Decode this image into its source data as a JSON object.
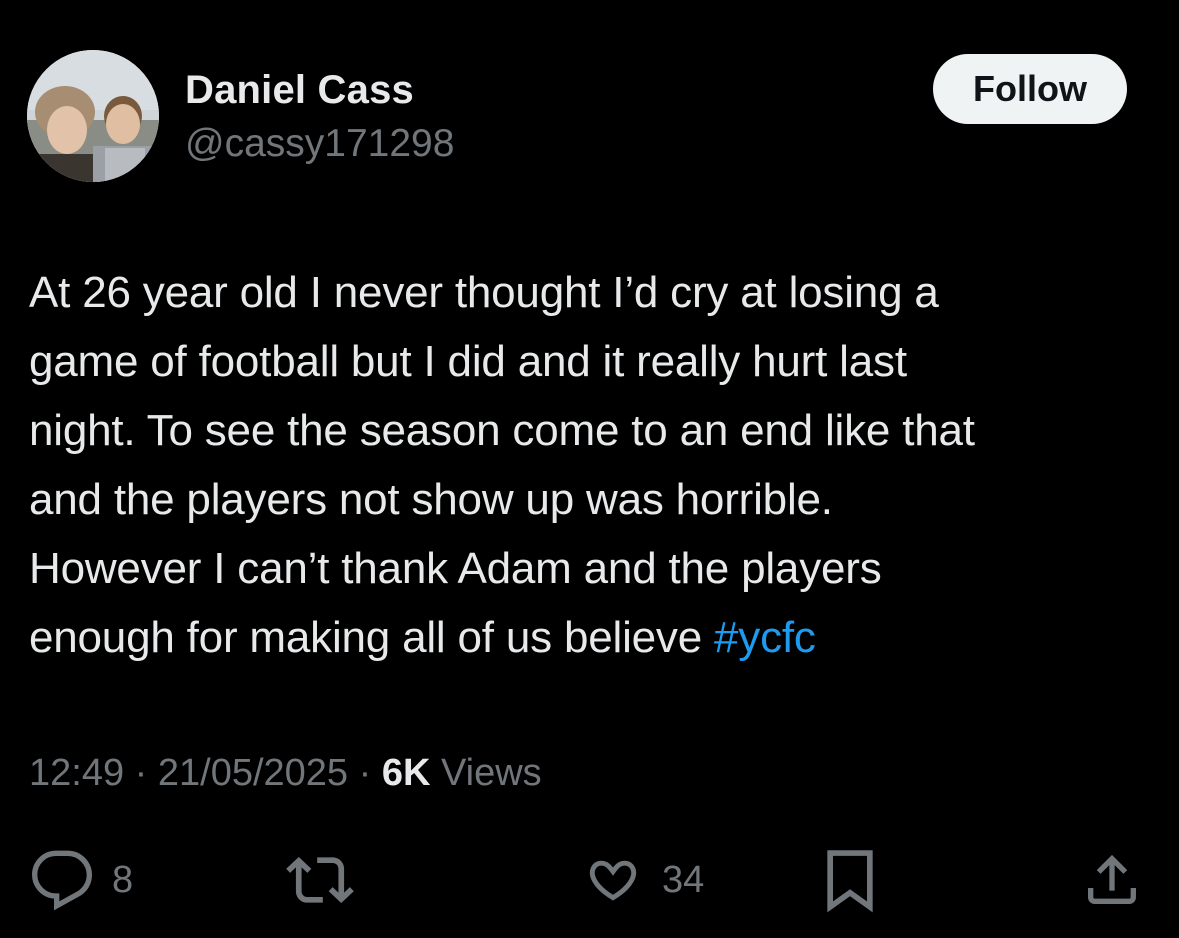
{
  "author": {
    "name": "Daniel Cass",
    "handle": "@cassy171298",
    "follow_label": "Follow"
  },
  "tweet": {
    "lines": [
      "At 26 year old I never thought I’d cry at losing a",
      "game of football but I did and it really hurt last",
      "night. To see the season come to an end like that",
      "and the players not show up was horrible.",
      "However I can’t thank Adam and the players"
    ],
    "last_line_text": "enough for making all of us believe ",
    "hashtag": "#ycfc"
  },
  "meta": {
    "time": "12:49",
    "separator": "·",
    "date": "21/05/2025",
    "views_count": "6K",
    "views_label": "Views"
  },
  "actions": {
    "replies": "8",
    "retweets": "",
    "likes": "34"
  },
  "icons": {
    "reply": "reply-icon",
    "retweet": "retweet-icon",
    "like": "heart-icon",
    "bookmark": "bookmark-icon",
    "share": "share-icon"
  },
  "colors": {
    "background": "#000000",
    "text": "#e7e9ea",
    "secondary": "#71767b",
    "link": "#1d9bf0",
    "follow_bg": "#eff3f4"
  }
}
